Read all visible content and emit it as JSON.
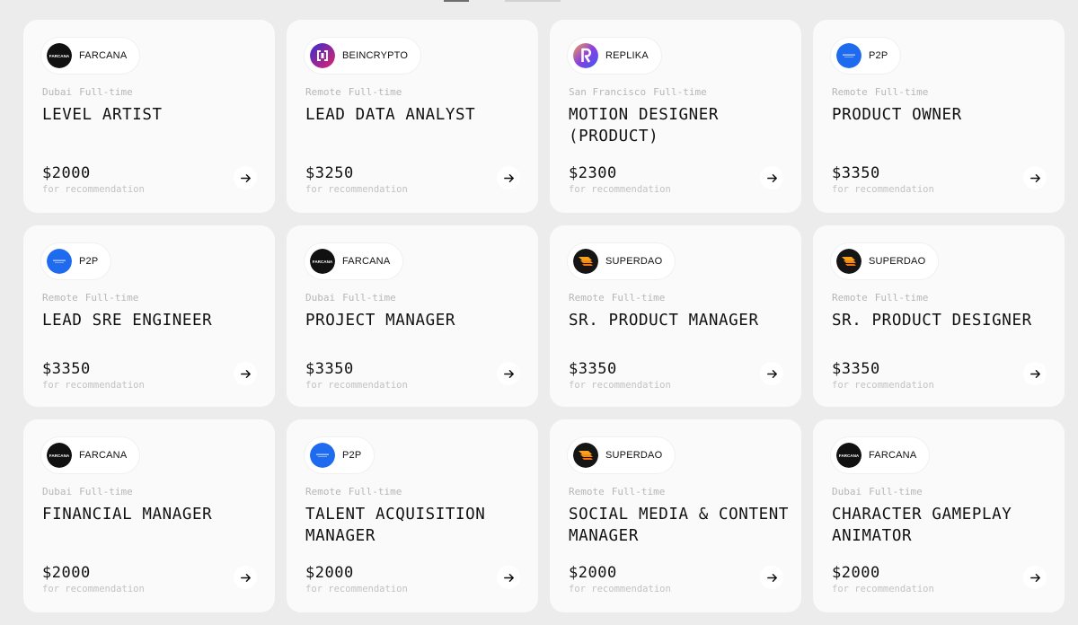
{
  "cards": [
    {
      "company": "FARCANA",
      "logo": "farcana",
      "logo_text": "FARCANA",
      "location": "Dubai",
      "type": "Full-time",
      "title": "LEVEL ARTIST",
      "price": "$2000",
      "note": "for recommendation"
    },
    {
      "company": "BEINCRYPTO",
      "logo": "beincrypto",
      "logo_text": "",
      "location": "Remote",
      "type": "Full-time",
      "title": "LEAD DATA ANALYST",
      "price": "$3250",
      "note": "for recommendation"
    },
    {
      "company": "REPLIKA",
      "logo": "replika",
      "logo_text": "",
      "location": "San Francisco",
      "type": "Full-time",
      "title": "MOTION DESIGNER (PRODUCT)",
      "price": "$2300",
      "note": "for recommendation"
    },
    {
      "company": "P2P",
      "logo": "p2p",
      "logo_text": "",
      "location": "Remote",
      "type": "Full-time",
      "title": "PRODUCT OWNER",
      "price": "$3350",
      "note": "for recommendation"
    },
    {
      "company": "P2P",
      "logo": "p2p",
      "logo_text": "",
      "location": "Remote",
      "type": "Full-time",
      "title": "LEAD SRE ENGINEER",
      "price": "$3350",
      "note": "for recommendation"
    },
    {
      "company": "FARCANA",
      "logo": "farcana",
      "logo_text": "FARCANA",
      "location": "Dubai",
      "type": "Full-time",
      "title": "PROJECT MANAGER",
      "price": "$3350",
      "note": "for recommendation"
    },
    {
      "company": "SUPERDAO",
      "logo": "superdao",
      "logo_text": "",
      "location": "Remote",
      "type": "Full-time",
      "title": "SR. PRODUCT MANAGER",
      "price": "$3350",
      "note": "for recommendation"
    },
    {
      "company": "SUPERDAO",
      "logo": "superdao",
      "logo_text": "",
      "location": "Remote",
      "type": "Full-time",
      "title": "SR. PRODUCT DESIGNER",
      "price": "$3350",
      "note": "for recommendation"
    },
    {
      "company": "FARCANA",
      "logo": "farcana",
      "logo_text": "FARCANA",
      "location": "Dubai",
      "type": "Full-time",
      "title": "FINANCIAL MANAGER",
      "price": "$2000",
      "note": "for recommendation"
    },
    {
      "company": "P2P",
      "logo": "p2p",
      "logo_text": "",
      "location": "Remote",
      "type": "Full-time",
      "title": "TALENT ACQUISITION MANAGER",
      "price": "$2000",
      "note": "for recommendation"
    },
    {
      "company": "SUPERDAO",
      "logo": "superdao",
      "logo_text": "",
      "location": "Remote",
      "type": "Full-time",
      "title": "SOCIAL MEDIA & CONTENT MANAGER",
      "price": "$2000",
      "note": "for recommendation"
    },
    {
      "company": "FARCANA",
      "logo": "farcana",
      "logo_text": "FARCANA",
      "location": "Dubai",
      "type": "Full-time",
      "title": "CHARACTER GAMEPLAY ANIMATOR",
      "price": "$2000",
      "note": "for recommendation"
    }
  ]
}
